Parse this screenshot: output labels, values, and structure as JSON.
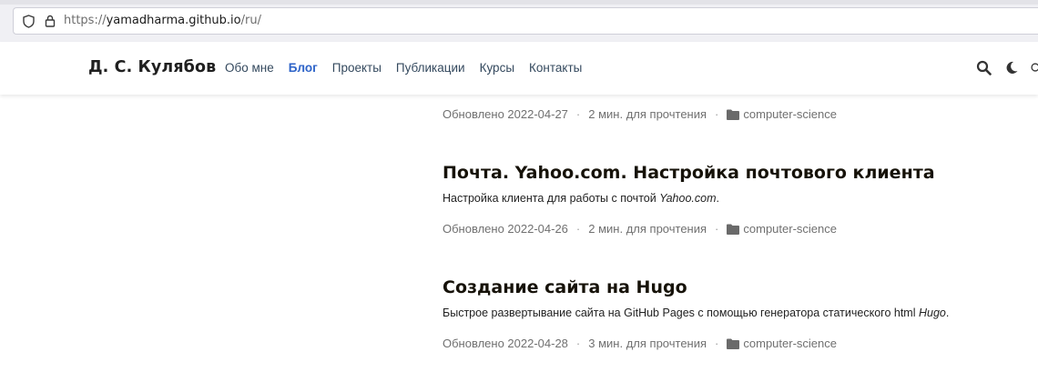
{
  "browser": {
    "url_scheme": "https://",
    "url_host": "yamadharma.github.io",
    "url_path": "/ru/"
  },
  "site": {
    "title": "Д. С. Кулябов",
    "nav": [
      {
        "label": "Обо мне"
      },
      {
        "label": "Блог"
      },
      {
        "label": "Проекты"
      },
      {
        "label": "Публикации"
      },
      {
        "label": "Курсы"
      },
      {
        "label": "Контакты"
      }
    ],
    "active_nav": "Блог",
    "accent_color": "#2d63c8"
  },
  "posts": [
    {
      "meta": {
        "updated": "Обновлено 2022-04-27",
        "reading": "2 мин. для прочтения",
        "category": "computer-science"
      }
    },
    {
      "title": "Почта. Yahoo.com. Настройка почтового клиента",
      "summary_text": "Настройка клиента для работы с почтой ",
      "summary_em": "Yahoo.com",
      "summary_end": ".",
      "meta": {
        "updated": "Обновлено 2022-04-26",
        "reading": "2 мин. для прочтения",
        "category": "computer-science"
      }
    },
    {
      "title": "Создание сайта на Hugo",
      "summary_text": "Быстрое развертывание сайта на GitHub Pages с помощью генератора статического html ",
      "summary_em": "Hugo",
      "summary_end": ".",
      "meta": {
        "updated": "Обновлено 2022-04-28",
        "reading": "3 мин. для прочтения",
        "category": "computer-science"
      }
    }
  ],
  "icons": {
    "shield": "shield-icon",
    "lock": "lock-icon",
    "search": "search-icon",
    "theme": "moon-icon",
    "folder": "folder-icon"
  }
}
